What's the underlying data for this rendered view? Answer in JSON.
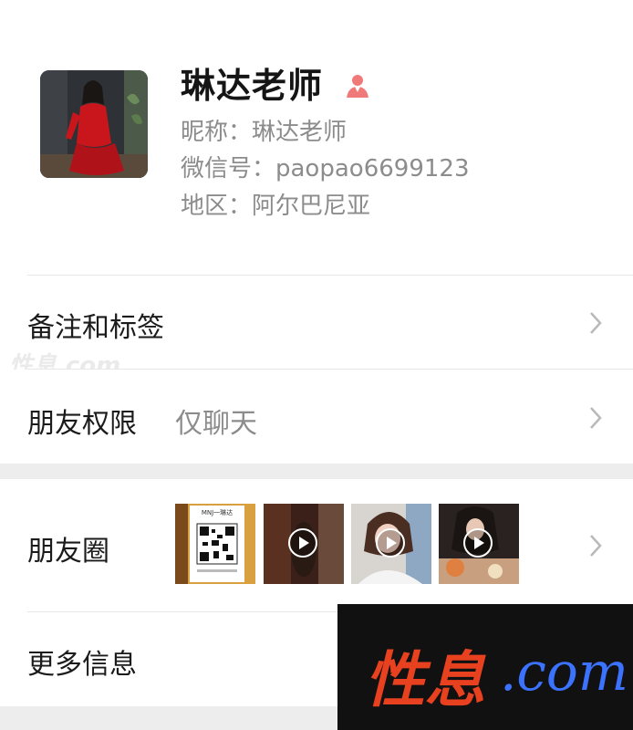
{
  "profile": {
    "name": "琳达老师",
    "nickname": "昵称：琳达老师",
    "wechat_id": "微信号：paopao6699123",
    "region": "地区：阿尔巴尼亚"
  },
  "rows": {
    "remark": {
      "label": "备注和标签"
    },
    "permission": {
      "label": "朋友权限",
      "value": "仅聊天"
    },
    "moments": {
      "label": "朋友圈"
    },
    "more": {
      "label": "更多信息"
    }
  },
  "moments_thumbs": [
    {
      "caption": "MNJ一琳达",
      "type": "image"
    },
    {
      "type": "video"
    },
    {
      "type": "video"
    },
    {
      "type": "video"
    }
  ],
  "watermark": {
    "brand_cn": "性息",
    "brand_dom": ".com"
  },
  "colors": {
    "gender": "#f07a7a",
    "watermark_red": "#e8411f",
    "watermark_blue": "#3b73ff",
    "separator": "#ededed"
  }
}
